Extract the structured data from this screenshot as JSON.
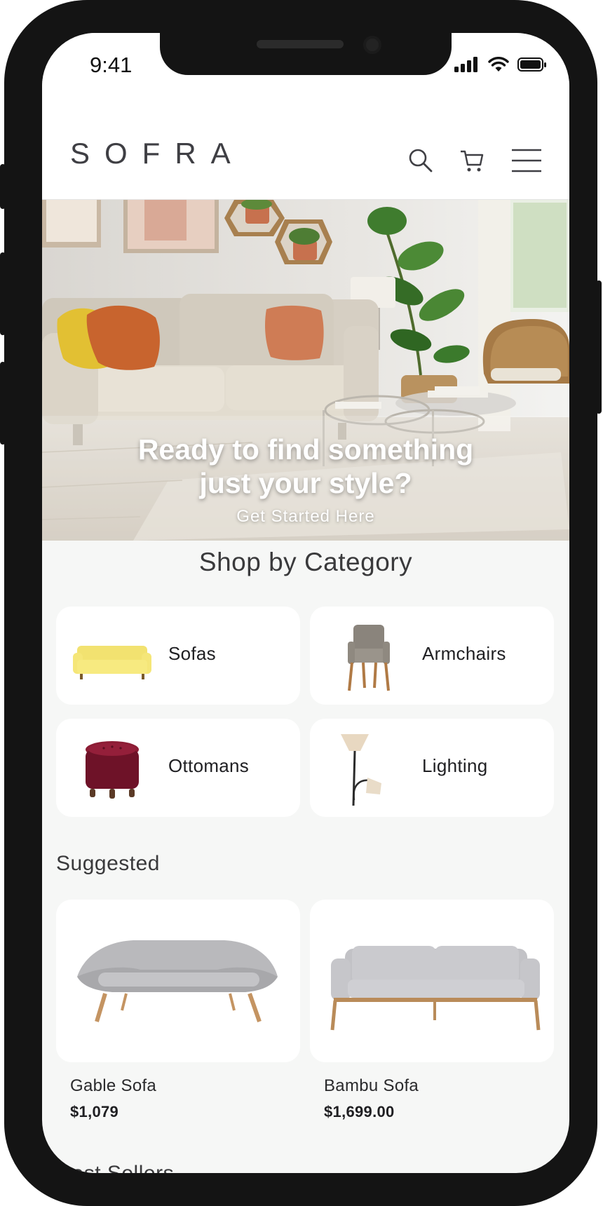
{
  "status_bar": {
    "time": "9:41"
  },
  "header": {
    "logo": "SOFRA",
    "icons": [
      "search-icon",
      "cart-icon",
      "menu-icon"
    ]
  },
  "hero": {
    "title_line1": "Ready to find something",
    "title_line2": "just your style?",
    "cta": "Get Started Here"
  },
  "categories": {
    "title": "Shop by Category",
    "items": [
      {
        "label": "Sofas",
        "icon": "yellow-sofa-image"
      },
      {
        "label": "Armchairs",
        "icon": "armchair-image"
      },
      {
        "label": "Ottomans",
        "icon": "ottoman-image"
      },
      {
        "label": "Lighting",
        "icon": "floor-lamp-image"
      }
    ]
  },
  "suggested": {
    "title": "Suggested",
    "items": [
      {
        "name": "Gable Sofa",
        "price": "$1,079"
      },
      {
        "name": "Bambu Sofa",
        "price": "$1,699.00"
      }
    ]
  },
  "next_section": {
    "title": "Best Sellers"
  },
  "colors": {
    "background": "#f6f7f6",
    "card": "#ffffff",
    "text": "#3a3a3c",
    "frame": "#141414"
  }
}
